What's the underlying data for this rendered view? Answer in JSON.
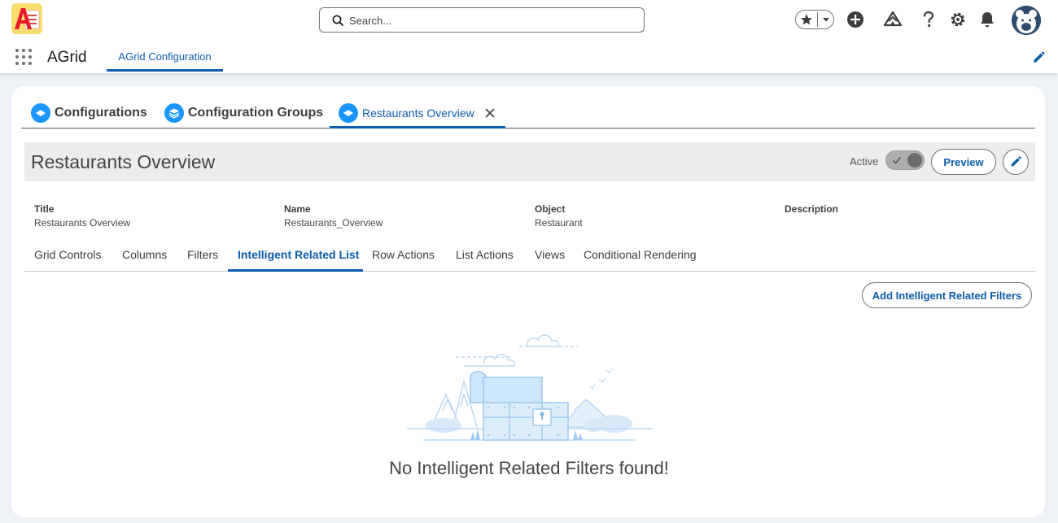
{
  "header": {
    "search_placeholder": "Search...",
    "icons": [
      "app-logo",
      "search-icon",
      "star-icon",
      "chevron-down-icon",
      "add-icon",
      "trailhead-icon",
      "help-icon",
      "gear-icon",
      "bell-icon",
      "avatar"
    ]
  },
  "app_nav": {
    "app_name": "AGrid",
    "tab_label": "AGrid Configuration"
  },
  "workspace_tabs": [
    {
      "label": "Configurations"
    },
    {
      "label": "Configuration Groups"
    },
    {
      "label": "Restaurants Overview",
      "active": true
    }
  ],
  "record": {
    "title": "Restaurants Overview",
    "status_label": "Active",
    "active": true,
    "preview_label": "Preview",
    "fields": [
      {
        "label": "Title",
        "value": "Restaurants Overview"
      },
      {
        "label": "Name",
        "value": "Restaurants_Overview"
      },
      {
        "label": "Object",
        "value": "Restaurant"
      },
      {
        "label": "Description",
        "value": ""
      }
    ]
  },
  "sub_tabs": [
    {
      "label": "Grid Controls"
    },
    {
      "label": "Columns"
    },
    {
      "label": "Filters"
    },
    {
      "label": "Intelligent Related List",
      "active": true
    },
    {
      "label": "Row Actions"
    },
    {
      "label": "List Actions"
    },
    {
      "label": "Views"
    },
    {
      "label": "Conditional Rendering"
    }
  ],
  "content": {
    "add_button_label": "Add Intelligent Related Filters",
    "empty_message": "No Intelligent Related Filters found!"
  },
  "colors": {
    "brand": "#0b5cab",
    "tab_icon": "#1b96ff",
    "illustration": "#cfe7fb"
  }
}
